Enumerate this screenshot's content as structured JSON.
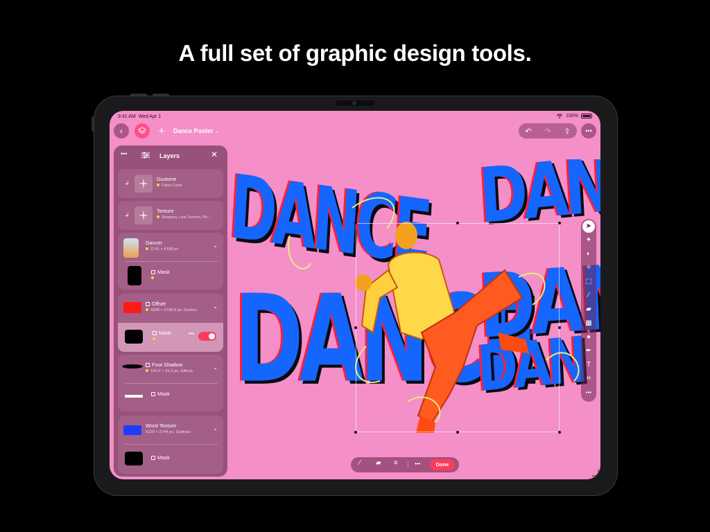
{
  "headline": "A full set of graphic design tools.",
  "status": {
    "time": "9:41 AM",
    "date": "Wed Apr 1",
    "battery": "100%"
  },
  "topbar": {
    "document_title": "Dance Poster",
    "title_chevron": "⌄"
  },
  "artwork": {
    "words": [
      "DANCE",
      "DANC",
      "DANCE",
      "DAN",
      "DAN"
    ],
    "colors": {
      "primary": "#1565ff",
      "offset": "#ff1f3a",
      "shadow": "#0a0a12",
      "canvas": "#f48fc8"
    }
  },
  "layers_panel": {
    "title": "Layers",
    "layers": [
      {
        "name": "Duotone",
        "detail": "False Color",
        "kind": "filter"
      },
      {
        "name": "Texture",
        "detail": "Sharpen, Line Screen, Po...",
        "kind": "filter"
      },
      {
        "name": "Dancer",
        "detail": "2741 × 4108 px",
        "kind": "image",
        "mask": {
          "name": "Mask"
        }
      },
      {
        "name": "Offset",
        "detail": "4308 × 2738.8 px, Darken",
        "kind": "group",
        "mask": {
          "name": "Mask",
          "selected": true,
          "enabled": true
        }
      },
      {
        "name": "Foot Shadow",
        "detail": "154.6 × 25.3 px, Effects",
        "kind": "group",
        "mask": {
          "name": "Mask"
        }
      },
      {
        "name": "Word Texture",
        "detail": "5129 × 2744 px, Subtract",
        "kind": "image",
        "mask": {
          "name": "Mask"
        }
      }
    ]
  },
  "bottom_toolbar": {
    "done_label": "Done"
  }
}
